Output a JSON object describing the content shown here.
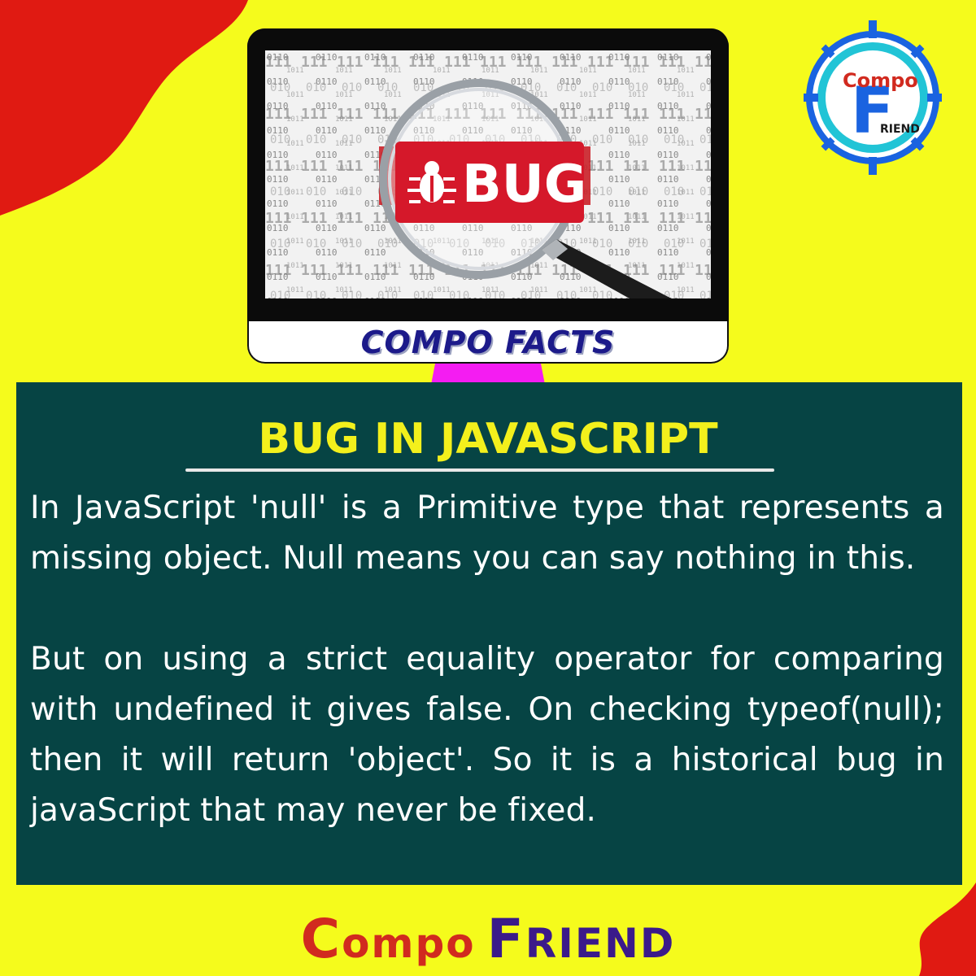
{
  "colors": {
    "background": "#f5fb1c",
    "accent_red": "#e01a12",
    "panel": "#064444",
    "title": "#f3f01c",
    "stand": "#f41cf2",
    "caption": "#1c1a8a"
  },
  "monitor": {
    "screen_badge": "BUG",
    "caption": "COMPO FACTS"
  },
  "logo": {
    "top_word": "Compo",
    "bottom_word": "RIEND",
    "initial": "F"
  },
  "article": {
    "title": "BUG IN JAVASCRIPT",
    "paragraphs": [
      "In JavaScript 'null' is a Primitive type that represents a missing object. Null means you can say nothing in this.",
      "But on using a strict equality operator for comparing with undefined it gives false. On checking typeof(null); then it will return 'object'. So it is a historical bug in javaScript that may never be fixed."
    ]
  },
  "footer": {
    "brand_c": "C",
    "brand_ompo": "ompo",
    "brand_f": "F",
    "brand_riend": "RIEND"
  }
}
